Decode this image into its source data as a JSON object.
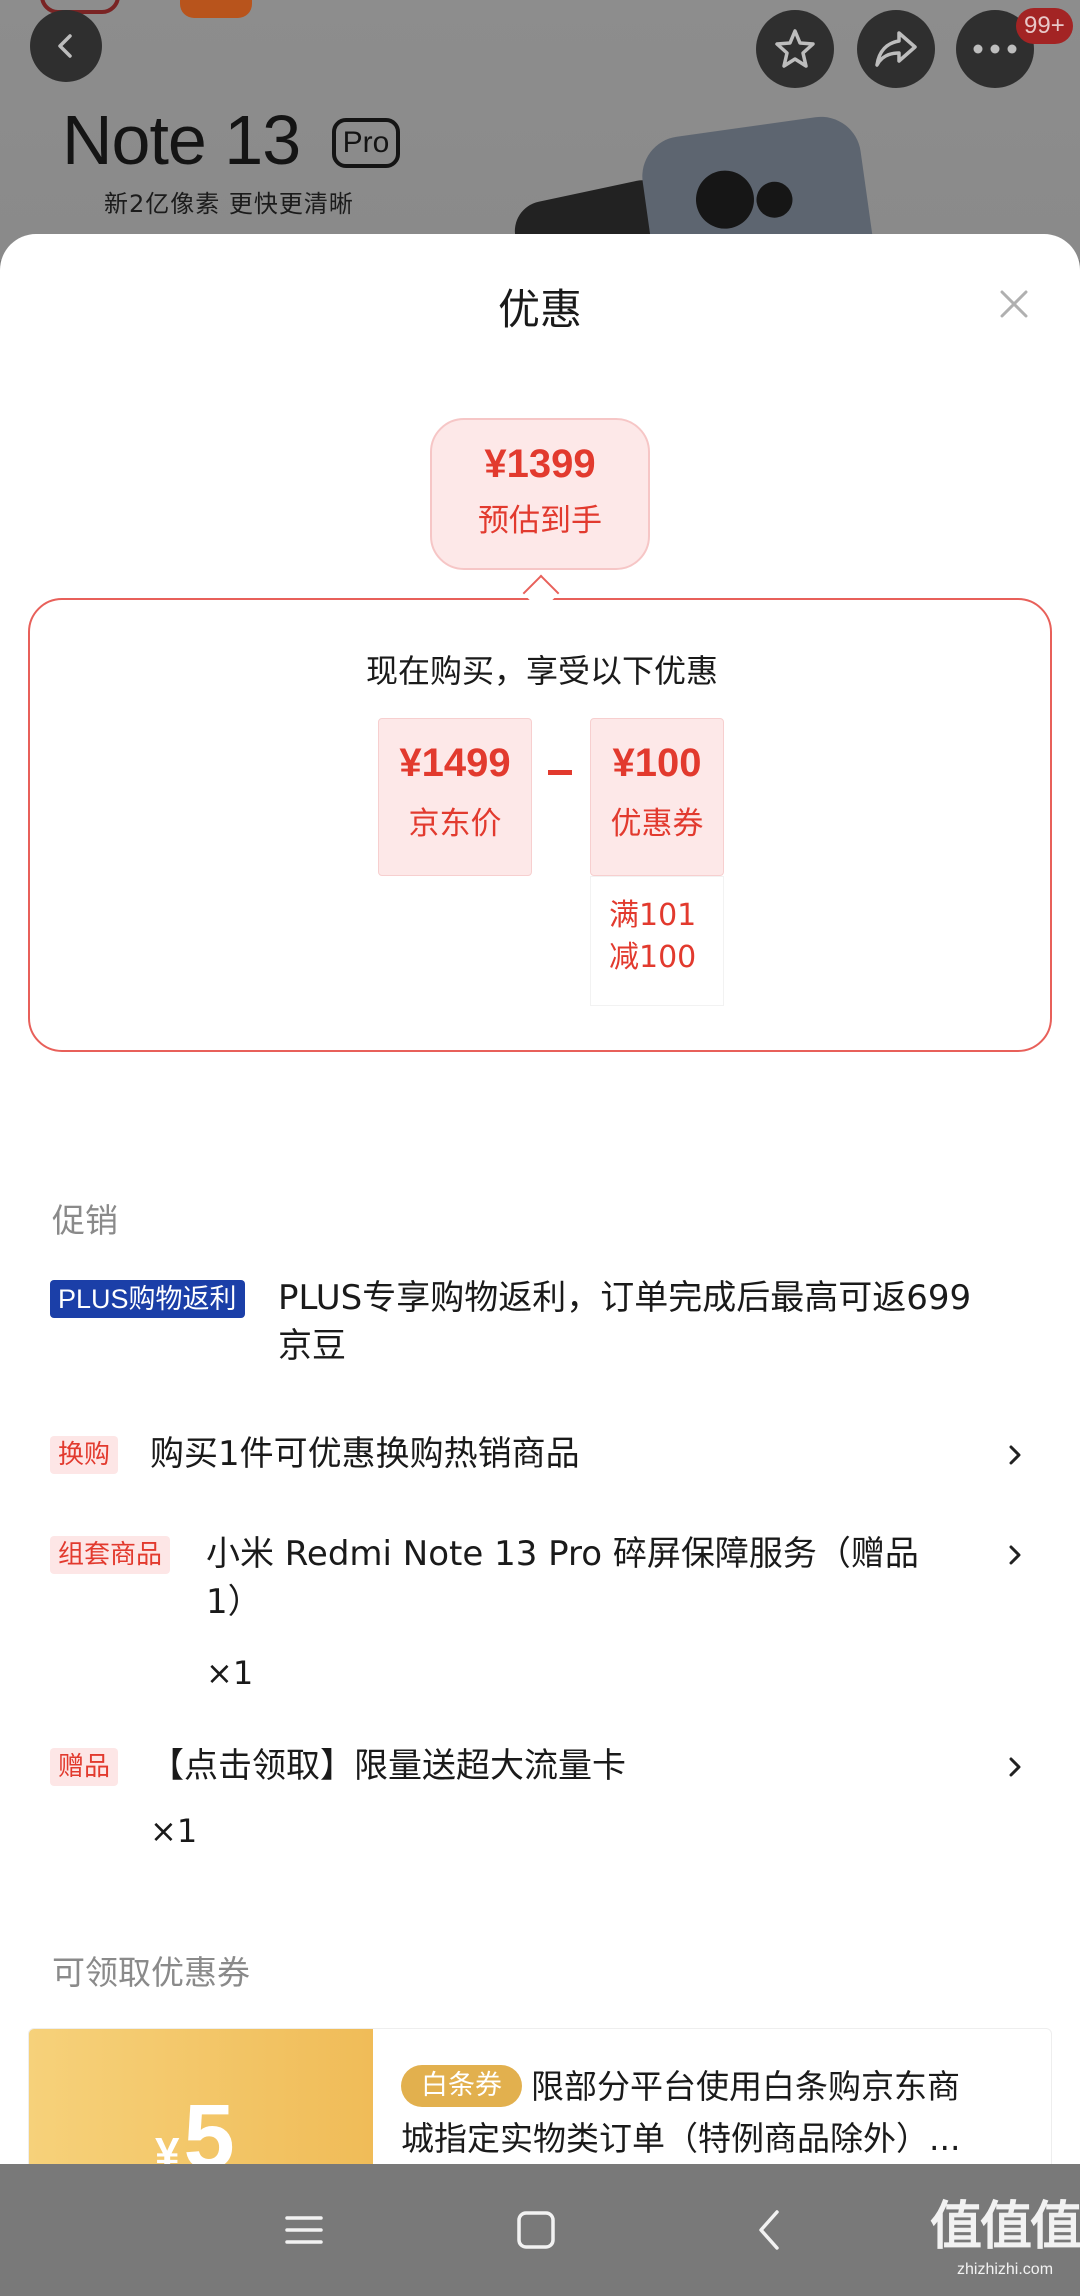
{
  "product_banner": {
    "title": "Note 13",
    "title_badge": "Pro",
    "subtitle": "新2亿像素 更快更清晰"
  },
  "top_bar": {
    "badge_count": "99+"
  },
  "sheet": {
    "title": "优惠",
    "estimate": {
      "price": "¥1399",
      "label": "预估到手"
    },
    "calculation": {
      "heading": "现在购买，享受以下优惠",
      "base_price": "¥1499",
      "base_label": "京东价",
      "coupon_value": "¥100",
      "coupon_label": "优惠券",
      "coupon_condition_line1": "满101",
      "coupon_condition_line2": "减100"
    },
    "promotions": {
      "label": "促销",
      "items": [
        {
          "tag": "PLUS购物返利",
          "text_line1": "PLUS专享购物返利，订单完成后最高可返699",
          "text_line2": "京豆"
        },
        {
          "tag": "换购",
          "text_line1": "购买1件可优惠换购热销商品"
        },
        {
          "tag": "组套商品",
          "text_line1": "小米 Redmi Note 13 Pro 碎屏保障服务（赠品",
          "text_line2": "1）",
          "qty": "×1"
        },
        {
          "tag": "赠品",
          "text_line1": "【点击领取】限量送超大流量卡",
          "qty": "×1"
        }
      ]
    },
    "coupons": {
      "label": "可领取优惠券",
      "items": [
        {
          "currency": "¥",
          "amount": "5",
          "tag": "白条券",
          "description_line1": "限部分平台使用白条购京东商",
          "description_line2": "城指定实物类订单（特例商品除外）..."
        }
      ]
    }
  },
  "watermark": {
    "main": "值值值",
    "sub": "zhizhizhi.com"
  },
  "colors": {
    "accent_red": "#e23a2e",
    "plus_blue": "#1b3fa8",
    "coupon_gold": "#f0bc58"
  }
}
